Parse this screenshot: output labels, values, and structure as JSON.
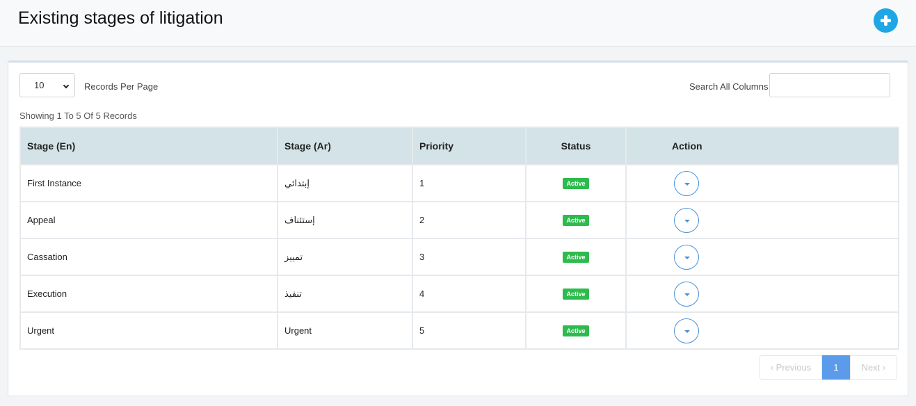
{
  "header": {
    "title": "Existing stages of litigation",
    "add_icon": "plus-circle-icon",
    "accent": "#1ea7e4"
  },
  "controls": {
    "per_page_value": "10",
    "per_page_label": "Records Per Page",
    "search_label": "Search All Columns",
    "search_value": "",
    "showing": "Showing 1 To 5 Of 5 Records"
  },
  "table": {
    "columns": [
      "Stage (En)",
      "Stage (Ar)",
      "Priority",
      "Status",
      "Action"
    ],
    "rows": [
      {
        "en": "First Instance",
        "ar": "إبتدائي",
        "priority": "1",
        "status": "Active"
      },
      {
        "en": "Appeal",
        "ar": "إستئناف",
        "priority": "2",
        "status": "Active"
      },
      {
        "en": "Cassation",
        "ar": "تمييز",
        "priority": "3",
        "status": "Active"
      },
      {
        "en": "Execution",
        "ar": "تنفيذ",
        "priority": "4",
        "status": "Active"
      },
      {
        "en": "Urgent",
        "ar": "Urgent",
        "priority": "5",
        "status": "Active"
      }
    ]
  },
  "pagination": {
    "previous": "‹  Previous",
    "current": "1",
    "next": "Next  ›"
  },
  "colors": {
    "header_bg": "#d3e3e7",
    "badge": "#2dbb4e",
    "page_active": "#5b9bea"
  }
}
